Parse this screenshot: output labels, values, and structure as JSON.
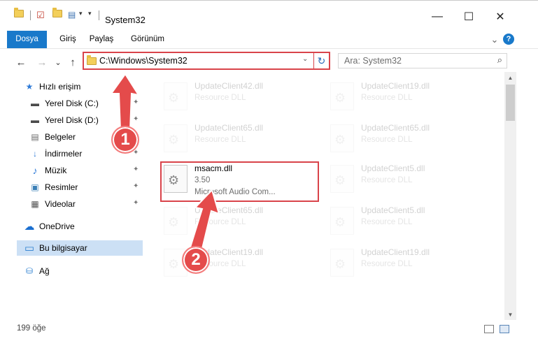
{
  "window": {
    "title": "System32",
    "minimize_glyph": "—",
    "maximize_glyph": "☐",
    "close_glyph": "✕"
  },
  "ribbon": {
    "tabs": [
      "Dosya",
      "Giriş",
      "Paylaş",
      "Görünüm"
    ],
    "expand_glyph": "⌄",
    "help_glyph": "?"
  },
  "nav": {
    "back": "←",
    "forward": "→",
    "recent": "⌄",
    "up": "↑"
  },
  "address": {
    "path": "C:\\Windows\\System32",
    "dropdown": "⌄",
    "refresh": "↻"
  },
  "search": {
    "placeholder": "Ara: System32",
    "icon": "⌕"
  },
  "sidebar": {
    "items": [
      {
        "label": "Hızlı erişim",
        "icon": "star-icon",
        "glyph": "★",
        "color": "#2f7bd8",
        "pinned": false
      },
      {
        "label": "Yerel Disk (C:)",
        "icon": "drive-icon",
        "glyph": "▬",
        "color": "#4a4a4a",
        "pinned": true
      },
      {
        "label": "Yerel Disk (D:)",
        "icon": "drive-icon",
        "glyph": "▬",
        "color": "#4a4a4a",
        "pinned": true
      },
      {
        "label": "Belgeler",
        "icon": "document-icon",
        "glyph": "▤",
        "color": "#6b6b6b",
        "pinned": true
      },
      {
        "label": "İndirmeler",
        "icon": "download-icon",
        "glyph": "↓",
        "color": "#2f7bd8",
        "pinned": true
      },
      {
        "label": "Müzik",
        "icon": "music-icon",
        "glyph": "♪",
        "color": "#2f7bd8",
        "pinned": true
      },
      {
        "label": "Resimler",
        "icon": "pictures-icon",
        "glyph": "▣",
        "color": "#3a7fb6",
        "pinned": true
      },
      {
        "label": "Videolar",
        "icon": "video-icon",
        "glyph": "▦",
        "color": "#555555",
        "pinned": true
      },
      {
        "label": "OneDrive",
        "icon": "cloud-icon",
        "glyph": "☁",
        "color": "#1a6fd0",
        "pinned": false
      },
      {
        "label": "Bu bilgisayar",
        "icon": "computer-icon",
        "glyph": "▭",
        "color": "#2b7fd0",
        "pinned": false
      },
      {
        "label": "Ağ",
        "icon": "network-icon",
        "glyph": "⛁",
        "color": "#2b7fd0",
        "pinned": false
      }
    ],
    "pin_glyph": "📌"
  },
  "files": [
    {
      "name": "UpdateClient42.dll",
      "desc": "Resource DLL",
      "faded": true
    },
    {
      "name": "UpdateClient19.dll",
      "desc": "Resource DLL",
      "faded": true
    },
    {
      "name": "UpdateClient65.dll",
      "desc": "Resource DLL",
      "faded": true
    },
    {
      "name": "UpdateClient65.dll",
      "desc": "Resource DLL",
      "faded": true
    },
    {
      "name": "msacm.dll",
      "desc": "3.50",
      "sub": "Microsoft Audio Com...",
      "faded": false
    },
    {
      "name": "UpdateClient5.dll",
      "desc": "Resource DLL",
      "faded": true
    },
    {
      "name": "UpdateClient65.dll",
      "desc": "Resource DLL",
      "faded": true
    },
    {
      "name": "UpdateClient5.dll",
      "desc": "Resource DLL",
      "faded": true
    },
    {
      "name": "UpdateClient19.dll",
      "desc": "Resource DLL",
      "faded": true
    },
    {
      "name": "UpdateClient19.dll",
      "desc": "Resource DLL",
      "faded": true
    }
  ],
  "status": {
    "item_count": "199 öğe"
  },
  "annotations": {
    "step1": "1",
    "step2": "2",
    "color": "#e44b4b"
  }
}
